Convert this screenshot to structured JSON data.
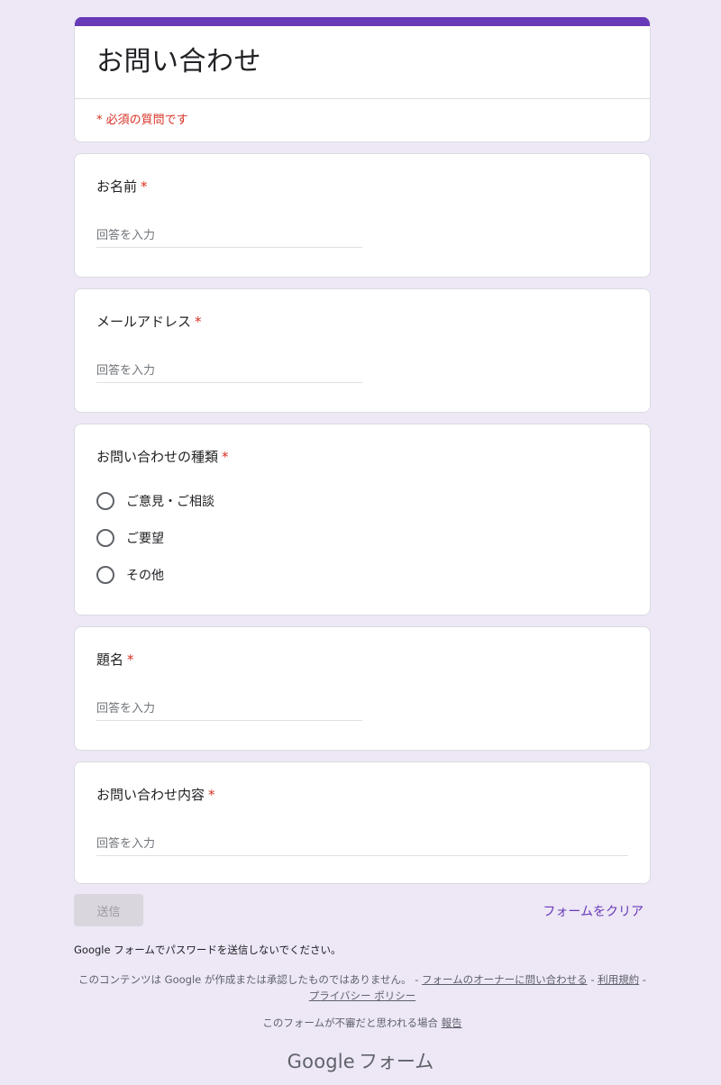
{
  "form": {
    "title": "お問い合わせ",
    "required_note": "* 必須の質問です",
    "accent_color": "#673ab7",
    "required_color": "#d93025"
  },
  "questions": {
    "name": {
      "label": "お名前",
      "required_mark": "*",
      "placeholder": "回答を入力"
    },
    "email": {
      "label": "メールアドレス",
      "required_mark": "*",
      "placeholder": "回答を入力"
    },
    "type": {
      "label": "お問い合わせの種類",
      "required_mark": "*",
      "options": [
        "ご意見・ご相談",
        "ご要望",
        "その他"
      ]
    },
    "subject": {
      "label": "題名",
      "required_mark": "*",
      "placeholder": "回答を入力"
    },
    "content": {
      "label": "お問い合わせ内容",
      "required_mark": "*",
      "placeholder": "回答を入力"
    }
  },
  "actions": {
    "submit_label": "送信",
    "clear_label": "フォームをクリア"
  },
  "footer": {
    "warning": "Google フォームでパスワードを送信しないでください。",
    "disclaimer_text": "このコンテンツは Google が作成または承認したものではありません。 -",
    "contact_owner_link": "フォームのオーナーに問い合わせる",
    "sep1": "-",
    "terms_link": "利用規約",
    "sep2": "-",
    "privacy_link": "プライバシー ポリシー",
    "report_text": "このフォームが不審だと思われる場合",
    "report_link": "報告",
    "logo_google": "Google",
    "logo_product": "フォーム"
  }
}
